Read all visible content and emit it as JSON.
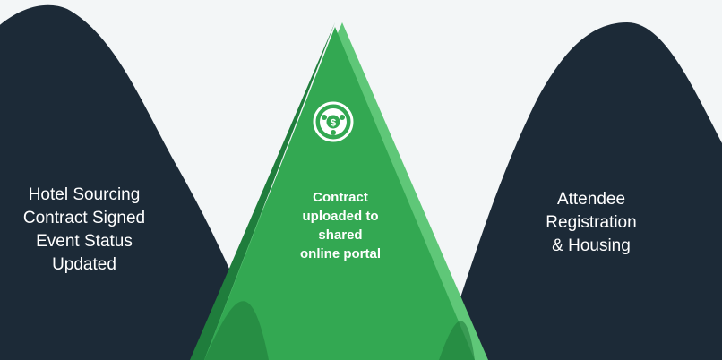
{
  "colors": {
    "background": "#f3f6f7",
    "dark_mound": "#1c2a37",
    "green_main": "#33a852",
    "green_light": "#5fc778",
    "green_dark": "#1f7d3c",
    "text_light": "#ffffff"
  },
  "stages": [
    {
      "label": "Hotel Sourcing\nContract Signed\nEvent Status\n  Updated"
    },
    {
      "label": "Contract\nuploaded to\nshared\nonline portal",
      "icon": "contract-portal-icon"
    },
    {
      "label": "Attendee\nRegistration\n& Housing"
    }
  ]
}
